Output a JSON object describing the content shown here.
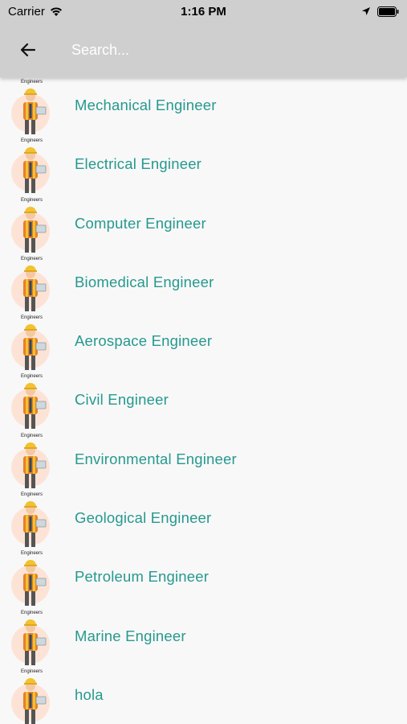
{
  "status_bar": {
    "carrier": "Carrier",
    "time": "1:16 PM"
  },
  "app_bar": {
    "back_icon": "arrow-left-icon",
    "search_placeholder": "Search...",
    "search_value": ""
  },
  "avatar_caption": "Engineers",
  "items": [
    {
      "label": "Mechanical Engineer"
    },
    {
      "label": "Electrical Engineer"
    },
    {
      "label": "Computer Engineer"
    },
    {
      "label": "Biomedical Engineer"
    },
    {
      "label": "Aerospace Engineer"
    },
    {
      "label": "Civil Engineer"
    },
    {
      "label": "Environmental Engineer"
    },
    {
      "label": "Geological Engineer"
    },
    {
      "label": "Petroleum Engineer"
    },
    {
      "label": "Marine Engineer"
    },
    {
      "label": "hola"
    }
  ],
  "colors": {
    "label": "#26998f",
    "app_bar": "#cfcfcf",
    "background": "#f8f8f8"
  }
}
